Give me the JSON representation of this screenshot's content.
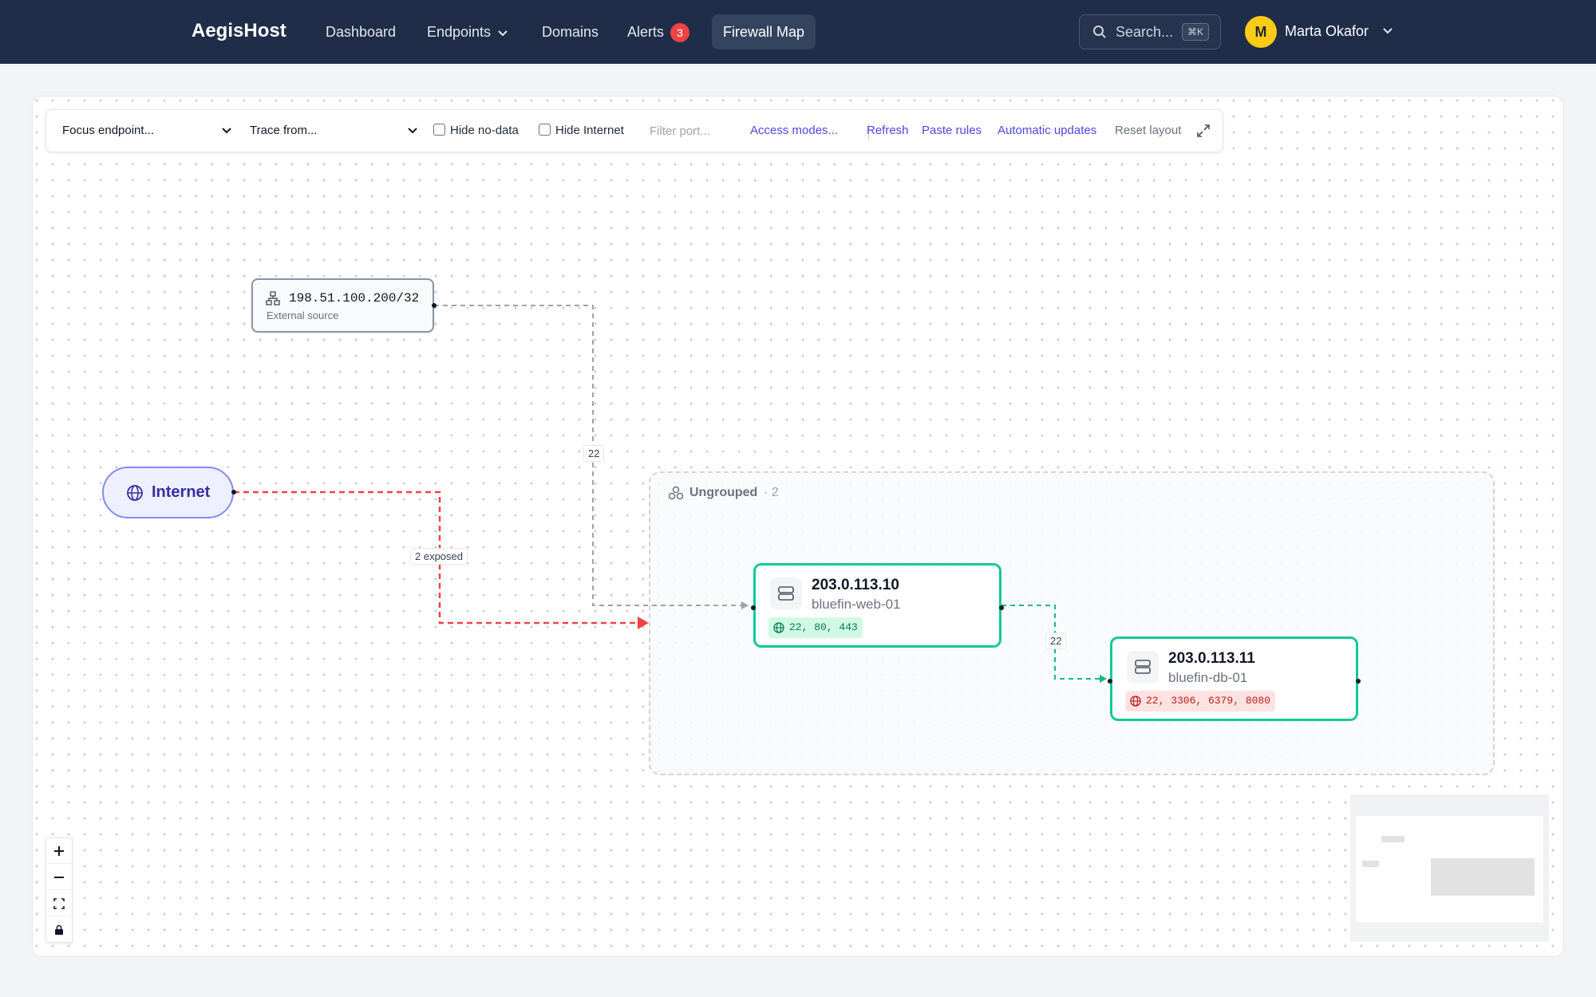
{
  "header": {
    "brand": "AegisHost",
    "nav": [
      {
        "label": "Dashboard"
      },
      {
        "label": "Endpoints",
        "icon": "chevron-down-icon"
      },
      {
        "label": "Domains"
      },
      {
        "label": "Alerts",
        "badge": "3"
      },
      {
        "label": "Firewall Map",
        "active": true
      }
    ],
    "search": {
      "placeholder": "Search...",
      "shortcut": "⌘K"
    },
    "user": {
      "initial": "M",
      "name": "Marta Okafor"
    }
  },
  "toolbar": {
    "focus_select": "Focus endpoint...",
    "trace_select": "Trace from...",
    "hide_no_data": {
      "label": "Hide no-data",
      "checked": false
    },
    "hide_internet": {
      "label": "Hide Internet",
      "checked": false
    },
    "filter_placeholder": "Filter port...",
    "access_modes": "Access modes...",
    "refresh": "Refresh",
    "paste_rules": "Paste rules",
    "automatic_updates": "Automatic updates",
    "reset_layout": "Reset layout"
  },
  "graph": {
    "external_source": {
      "ip": "198.51.100.200/32",
      "label": "External source"
    },
    "internet": {
      "label": "Internet"
    },
    "group": {
      "title": "Ungrouped",
      "count": "· 2"
    },
    "endpoints": [
      {
        "ip": "203.0.113.10",
        "hostname": "bluefin-web-01",
        "ports": "22, 80, 443",
        "status": "ok"
      },
      {
        "ip": "203.0.113.11",
        "hostname": "bluefin-db-01",
        "ports": "22, 3306, 6379, 8080",
        "status": "exposed"
      }
    ],
    "edges": [
      {
        "from": "198.51.100.200/32",
        "to": "203.0.113.10",
        "label": "22",
        "color": "#9ca3af"
      },
      {
        "from": "Internet",
        "to": "Ungrouped",
        "label": "2 exposed",
        "color": "#ef4444"
      },
      {
        "from": "203.0.113.10",
        "to": "203.0.113.11",
        "label": "22",
        "color": "#10b981"
      }
    ]
  },
  "colors": {
    "nav_bg": "#1f2d48",
    "accent": "#4f46e5",
    "ok": "#10c998",
    "danger": "#ef4444"
  }
}
